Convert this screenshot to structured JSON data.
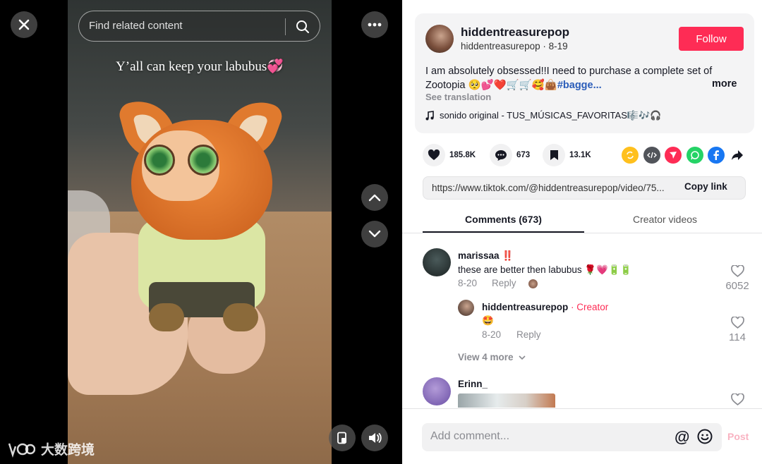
{
  "video": {
    "search_placeholder": "Find related content",
    "caption_overlay": "Y’all can keep your labubus💞",
    "watermark_text": "大数跨境"
  },
  "post": {
    "author_name": "hiddentreasurepop",
    "author_handle": "hiddentreasurepop",
    "date": "8-19",
    "follow_label": "Follow",
    "description": "I am absolutely obsessed!!I need to purchase a complete set of Zootopia 🥺💕❤️🛒🛒🥰👜",
    "hashtag": "#bagge...",
    "more_label": "more",
    "see_translation": "See translation",
    "music": "sonido original - TUS_MÚSICAS_FAVORITAS🎼🎶🎧"
  },
  "actions": {
    "likes": "185.8K",
    "comments": "673",
    "saves": "13.1K"
  },
  "share": {
    "link_url": "https://www.tiktok.com/@hiddentreasurepop/video/75...",
    "copy_label": "Copy link"
  },
  "tabs": {
    "comments": "Comments (673)",
    "creator_videos": "Creator videos"
  },
  "comments": [
    {
      "name": "marissaa ‼️",
      "text": "these are better then labubus 🌹💗🔋🔋",
      "date": "8-20",
      "reply_label": "Reply",
      "likes": "6052",
      "reply": {
        "name": "hiddentreasurepop",
        "creator_tag": " · Creator",
        "text": "🤩",
        "date": "8-20",
        "reply_label": "Reply",
        "likes": "114"
      },
      "view_more": "View 4 more"
    },
    {
      "name": "Erinn_"
    }
  ],
  "comment_bar": {
    "placeholder": "Add comment...",
    "mention": "@",
    "post_label": "Post"
  },
  "colors": {
    "accent": "#fe2c55",
    "hashtag": "#2b5db9",
    "muted": "#8a8b91"
  },
  "icons": [
    "close-icon",
    "search-icon",
    "more-icon",
    "chevron-up-icon",
    "chevron-down-icon",
    "pip-icon",
    "volume-icon",
    "heart-icon",
    "comment-icon",
    "bookmark-icon",
    "repost-icon",
    "embed-icon",
    "send-icon",
    "whatsapp-icon",
    "facebook-icon",
    "share-arrow-icon",
    "music-note-icon",
    "emoji-icon"
  ]
}
